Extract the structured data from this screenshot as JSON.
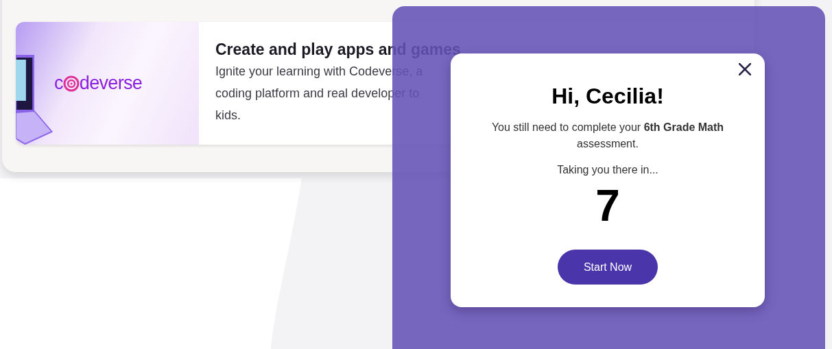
{
  "promo_card": {
    "logo": {
      "lead": "c",
      "tail": "deverse"
    },
    "title": "Create and play apps and games",
    "body_lines": [
      "Ignite your learning with Codeverse, a",
      "coding platform and real developer to",
      "kids."
    ]
  },
  "modal": {
    "title": "Hi, Cecilia!",
    "message": "You still need to complete your **6th Grade Math** assessment.",
    "countdown_label": "Taking you there in...",
    "countdown": "7",
    "button": "Start Now"
  }
}
